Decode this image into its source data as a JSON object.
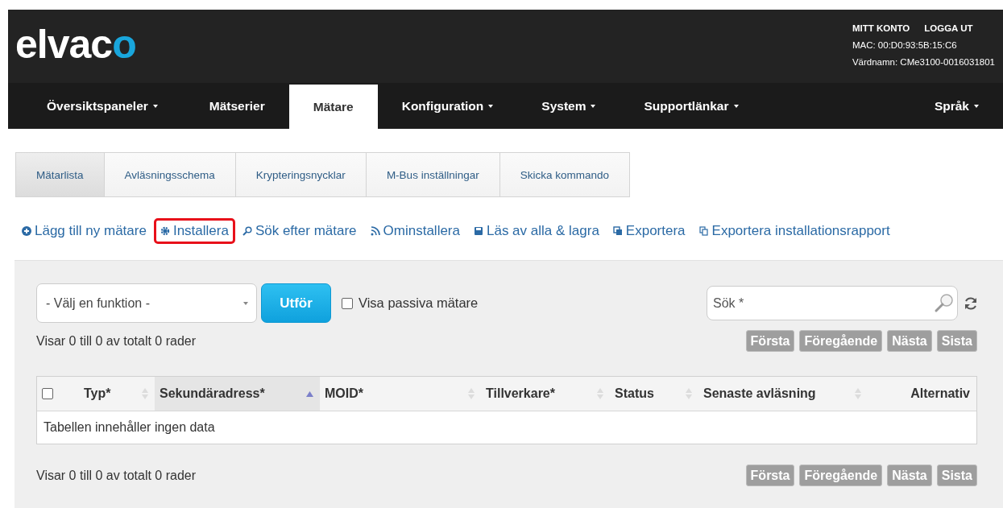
{
  "header": {
    "logo": "elvaco",
    "account_links": [
      "MITT KONTO",
      "LOGGA UT"
    ],
    "mac": "MAC: 00:D0:93:5B:15:C6",
    "hostname": "Värdnamn: CMe3100-0016031801"
  },
  "nav": [
    {
      "label": "Översiktspaneler",
      "dropdown": true,
      "selected": false
    },
    {
      "label": "Mätserier",
      "dropdown": false,
      "selected": false
    },
    {
      "label": "Mätare",
      "dropdown": false,
      "selected": true
    },
    {
      "label": "Konfiguration",
      "dropdown": true,
      "selected": false
    },
    {
      "label": "System",
      "dropdown": true,
      "selected": false
    },
    {
      "label": "Supportlänkar",
      "dropdown": true,
      "selected": false
    },
    {
      "label": "Språk",
      "dropdown": true,
      "selected": false
    }
  ],
  "tabs": [
    {
      "label": "Mätarlista",
      "selected": true
    },
    {
      "label": "Avläsningsschema",
      "selected": false
    },
    {
      "label": "Krypteringsnycklar",
      "selected": false
    },
    {
      "label": "M-Bus inställningar",
      "selected": false
    },
    {
      "label": "Skicka kommando",
      "selected": false
    }
  ],
  "actions": [
    {
      "label": "Lägg till ny mätare",
      "kind": "add",
      "highlighted": false
    },
    {
      "label": "Installera",
      "kind": "gear",
      "highlighted": true
    },
    {
      "label": "Sök efter mätare",
      "kind": "search",
      "highlighted": false
    },
    {
      "label": "Ominstallera",
      "kind": "feed",
      "highlighted": false
    },
    {
      "label": "Läs av alla & lagra",
      "kind": "save",
      "highlighted": false
    },
    {
      "label": "Exportera",
      "kind": "copy",
      "highlighted": false
    },
    {
      "label": "Exportera installationsrapport",
      "kind": "file",
      "highlighted": false
    }
  ],
  "toolbar": {
    "function_select": "- Välj en funktion -",
    "run_button": "Utför",
    "passive_checkbox": {
      "label": "Visa passiva mätare",
      "checked": false
    },
    "search": {
      "placeholder": "Sök *"
    }
  },
  "info_top": "Visar 0 till 0 av totalt 0 rader",
  "pagination_top": [
    {
      "label": "Första",
      "disabled": true
    },
    {
      "label": "Föregående",
      "disabled": true
    },
    {
      "label": "Nästa",
      "disabled": true
    },
    {
      "label": "Sista",
      "disabled": true
    }
  ],
  "table": {
    "select_all_checked": false,
    "columns": [
      {
        "label": "Typ*",
        "sortable": true,
        "sorted": false
      },
      {
        "label": "Sekundäradress*",
        "sortable": true,
        "sorted": true
      },
      {
        "label": "MOID*",
        "sortable": true,
        "sorted": false
      },
      {
        "label": "Tillverkare*",
        "sortable": true,
        "sorted": false
      },
      {
        "label": "Status",
        "sortable": true,
        "sorted": false
      },
      {
        "label": "Senaste avläsning",
        "sortable": true,
        "sorted": false
      },
      {
        "label": "Alternativ",
        "sortable": false,
        "sorted": false
      }
    ],
    "empty_message": "Tabellen innehåller ingen data"
  },
  "info_bottom": "Visar 0 till 0 av totalt 0 rader",
  "pagination_bottom": [
    {
      "label": "Första",
      "disabled": true
    },
    {
      "label": "Föregående",
      "disabled": true
    },
    {
      "label": "Nästa",
      "disabled": true
    },
    {
      "label": "Sista",
      "disabled": true
    }
  ]
}
